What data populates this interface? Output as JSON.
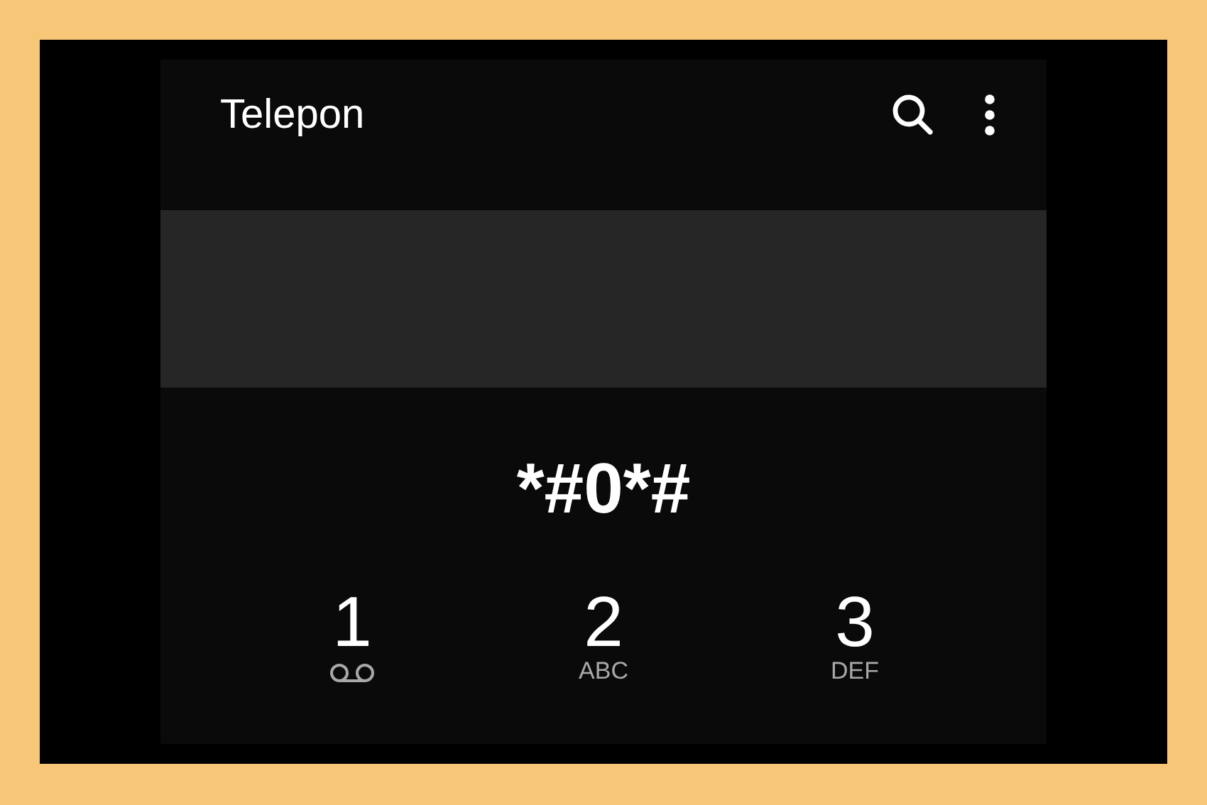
{
  "app_bar": {
    "title": "Telepon",
    "actions": [
      {
        "kind": "search"
      },
      {
        "kind": "more"
      }
    ]
  },
  "dialed_number": "*#0*#",
  "keypad": [
    {
      "digit": "1",
      "kind": "voicemail"
    },
    {
      "digit": "2",
      "kind": "letters",
      "letters": "ABC"
    },
    {
      "digit": "3",
      "kind": "letters",
      "letters": "DEF"
    }
  ]
}
